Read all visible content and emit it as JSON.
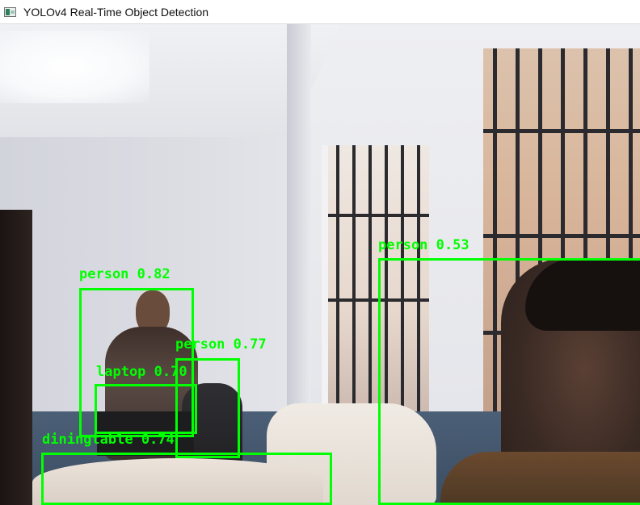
{
  "window": {
    "title": "YOLOv4 Real-Time Object Detection",
    "icon": "app-video-icon"
  },
  "detections": [
    {
      "class": "person",
      "label": "person 0.82",
      "confidence": 0.82
    },
    {
      "class": "person",
      "label": "person 0.77",
      "confidence": 0.77
    },
    {
      "class": "laptop",
      "label": "laptop 0.70",
      "confidence": 0.7
    },
    {
      "class": "diningtable",
      "label": "diningtable 0.74",
      "confidence": 0.74
    },
    {
      "class": "person",
      "label": "person 0.53",
      "confidence": 0.53
    }
  ],
  "colors": {
    "box": "#00ff00",
    "label": "#00ff00"
  }
}
